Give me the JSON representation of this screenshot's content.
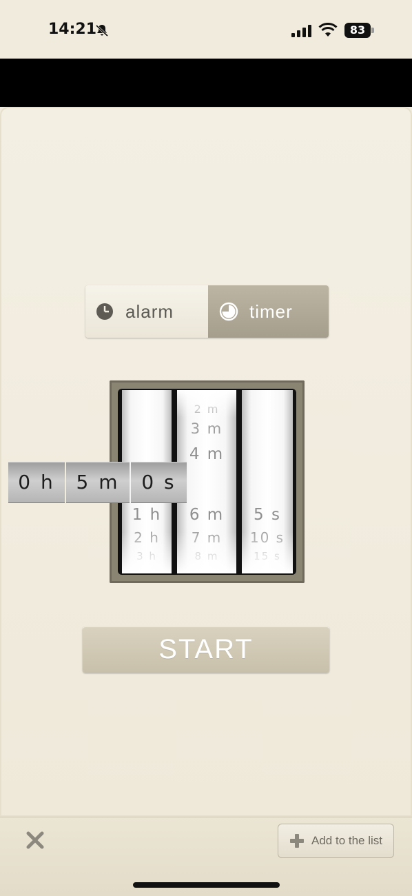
{
  "status_bar": {
    "time": "14:21",
    "battery": "83",
    "icons": [
      "bell-slash-icon",
      "signal-icon",
      "wifi-icon",
      "battery-icon"
    ]
  },
  "mode_selector": {
    "options": [
      {
        "label": "alarm",
        "icon": "clock-icon",
        "selected": false
      },
      {
        "label": "timer",
        "icon": "timer-icon",
        "selected": true
      }
    ]
  },
  "picker": {
    "hours": {
      "above": [],
      "selected": "0 h",
      "below": [
        "1 h",
        "2 h",
        "3 h"
      ]
    },
    "minutes": {
      "above": [
        "2 m",
        "3 m",
        "4 m"
      ],
      "selected": "5 m",
      "below": [
        "6 m",
        "7 m",
        "8 m"
      ]
    },
    "seconds": {
      "above": [],
      "selected": "0 s",
      "below": [
        "5 s",
        "10 s",
        "15 s"
      ]
    }
  },
  "start_button": {
    "label": "START"
  },
  "toolbar": {
    "close_icon": "close-icon",
    "add_label": "Add to the list",
    "add_icon": "plus-icon"
  },
  "colors": {
    "background": "#f0ebdd",
    "segment_selected": "#a59e8c",
    "start_button": "#c8c0aa",
    "picker_frame": "#8a8473"
  }
}
